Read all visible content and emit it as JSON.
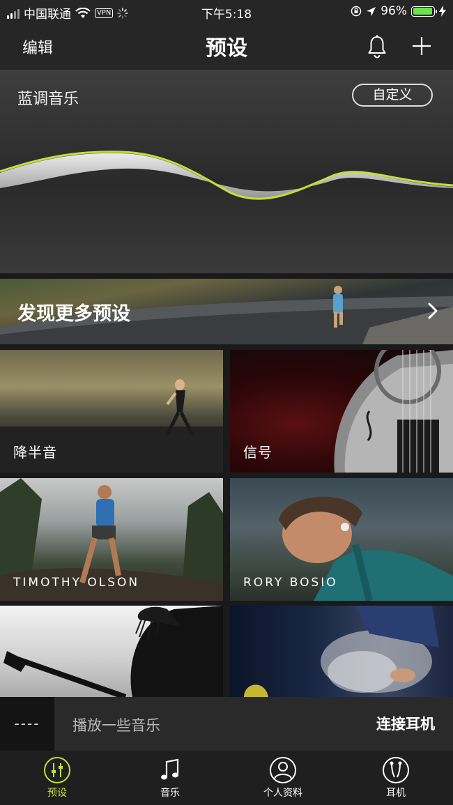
{
  "status_bar": {
    "carrier": "中国联通",
    "vpn": "VPN",
    "time": "下午5:18",
    "battery": "96%",
    "battery_level": 0.96
  },
  "nav": {
    "edit_label": "编辑",
    "title": "预设"
  },
  "preset": {
    "name": "蓝调音乐",
    "custom_label": "自定义",
    "curve_color": "#c2e03b"
  },
  "discover": {
    "title": "发现更多预设"
  },
  "tiles": [
    {
      "label": "降半音"
    },
    {
      "label": "信号"
    },
    {
      "label": "TIMOTHY OLSON"
    },
    {
      "label": "RORY BOSIO"
    },
    {
      "label": ""
    },
    {
      "label": ""
    }
  ],
  "now_playing": {
    "thumb": "----",
    "text": "播放一些音乐",
    "connect_label": "连接耳机"
  },
  "tabs": [
    {
      "label": "预设",
      "icon": "sliders-icon",
      "active": true
    },
    {
      "label": "音乐",
      "icon": "music-note-icon",
      "active": false
    },
    {
      "label": "个人资料",
      "icon": "profile-icon",
      "active": false
    },
    {
      "label": "耳机",
      "icon": "headphones-icon",
      "active": false
    }
  ],
  "colors": {
    "accent": "#c2e03b",
    "battery_green": "#6de24a",
    "background": "#1a1a1a"
  }
}
